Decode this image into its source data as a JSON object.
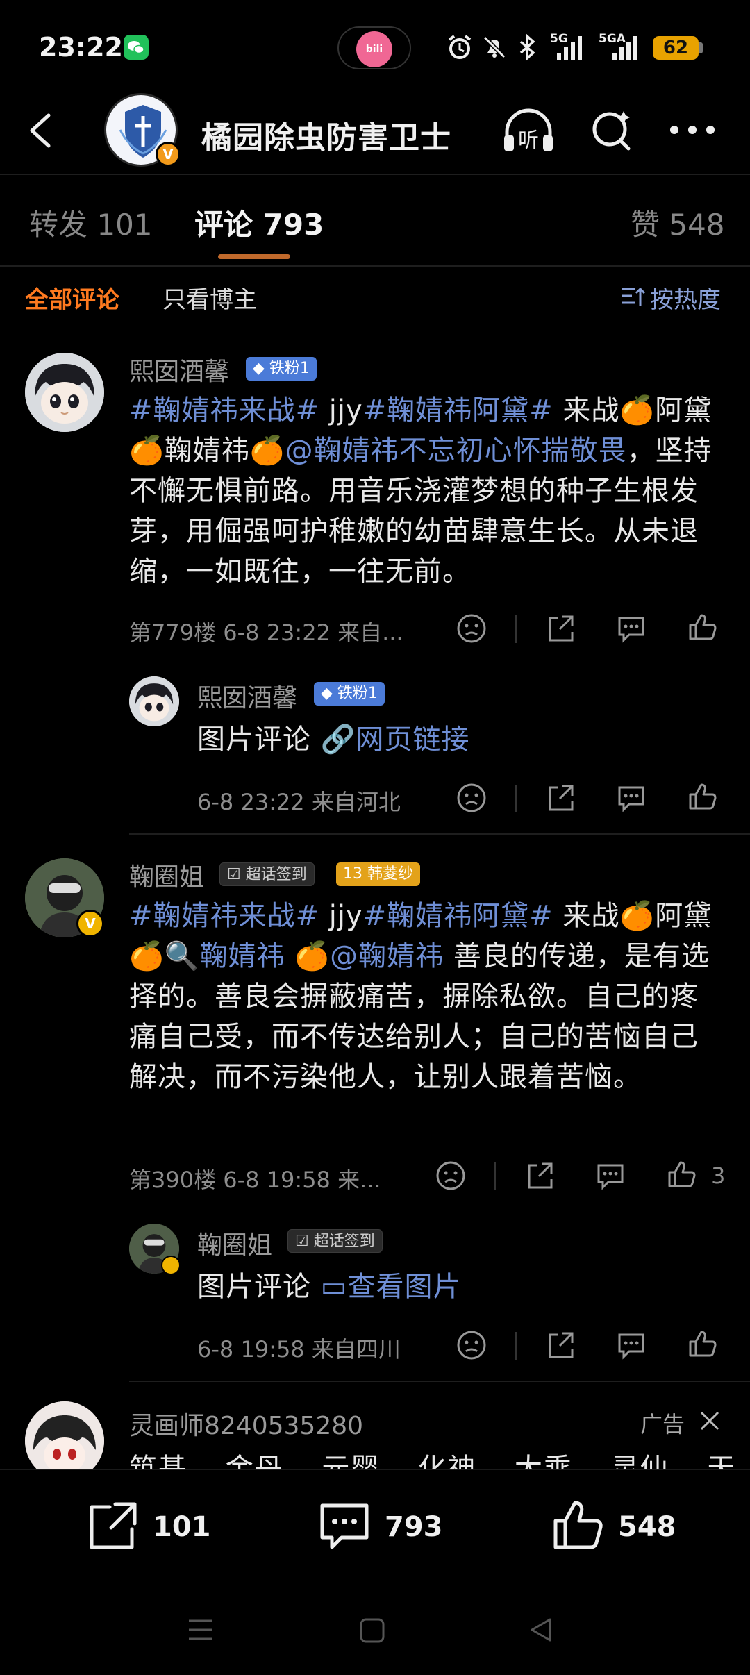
{
  "status": {
    "time": "23:22",
    "battery": "62",
    "net1": "5G",
    "net2": "5GA"
  },
  "header": {
    "title": "橘园除虫防害卫士",
    "verified_mark": "V"
  },
  "tabs": [
    {
      "label": "转发 101"
    },
    {
      "label": "评论 793"
    },
    {
      "label": "赞 548"
    }
  ],
  "filters": {
    "all": "全部评论",
    "author_only": "只看博主",
    "sort": "按热度"
  },
  "comments": [
    {
      "username": "熙囡酒馨",
      "badge": "铁粉1",
      "text_parts": [
        "#鞠婧祎来战#",
        " jjy",
        "#鞠婧祎阿黛#",
        " 来战🍊阿黛🍊鞠婧祎🍊",
        "@鞠婧祎不忘初心怀揣敬畏",
        "，坚持不懈无惧前路。用音乐浇灌梦想的种子生根发芽，用倔强呵护稚嫩的幼苗肆意生长。从未退缩，一如既往，一往无前。"
      ],
      "meta": "第779楼  6-8 23:22  来自...",
      "like_count": "",
      "reply": {
        "username": "熙囡酒馨",
        "badge": "铁粉1",
        "prefix": "图片评论",
        "link": "网页链接",
        "meta": "6-8 23:22  来自河北"
      }
    },
    {
      "username": "鞠圈姐",
      "badge_super": "超话签到",
      "badge_fan_level": "13",
      "badge_fan_name": "韩菱纱",
      "text_parts": [
        "#鞠婧祎来战#",
        " jjy",
        "#鞠婧祎阿黛#",
        " 来战🍊阿黛🍊",
        "鞠婧祎",
        " 🍊",
        "@鞠婧祎",
        " 善良的传递，是有选择的。善良会摒蔽痛苦，摒除私欲。自己的疼痛自己受，而不传达给别人；自己的苦恼自己解决，而不污染他人，让别人跟着苦恼。"
      ],
      "meta": "第390楼  6-8 19:58  来...",
      "like_count": "3",
      "reply": {
        "username": "鞠圈姐",
        "badge_super": "超话签到",
        "prefix": "图片评论",
        "link": "查看图片",
        "meta": "6-8 19:58  来自四川"
      }
    }
  ],
  "ad": {
    "username": "灵画师8240535280",
    "label": "广告",
    "words": "筑基 金丹 元婴 化神 大乘 灵仙 天"
  },
  "bottom_bar": {
    "repost_count": "101",
    "comment_count": "793",
    "like_count": "548"
  }
}
